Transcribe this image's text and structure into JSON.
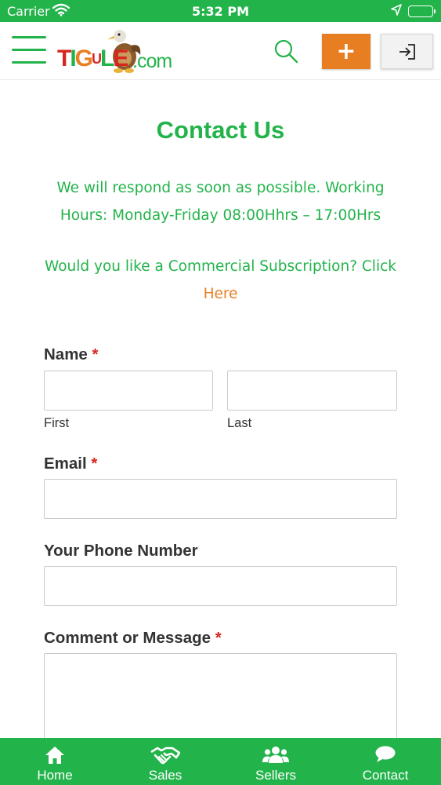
{
  "status_bar": {
    "carrier": "Carrier",
    "time": "5:32 PM"
  },
  "header": {
    "logo": {
      "letters": [
        "T",
        "I",
        "G",
        "U",
        "L",
        "E"
      ],
      "domain": ".com"
    },
    "add_label": "+"
  },
  "page": {
    "title": "Contact Us",
    "intro_line_1": "We will respond as soon as possible. Working",
    "intro_line_2": "Hours: Monday-Friday 08:00Hhrs – 17:00Hrs",
    "subscription_text": "Would you like a Commercial Subscription? Click",
    "subscription_link": "Here"
  },
  "form": {
    "required_marker": "*",
    "name_label": "Name",
    "first_label": "First",
    "last_label": "Last",
    "email_label": "Email",
    "phone_label": "Your Phone Number",
    "message_label": "Comment or Message",
    "first_value": "",
    "last_value": "",
    "email_value": "",
    "phone_value": "",
    "message_value": ""
  },
  "tab_bar": {
    "items": [
      {
        "label": "Home",
        "icon": "home-icon"
      },
      {
        "label": "Sales",
        "icon": "handshake-icon"
      },
      {
        "label": "Sellers",
        "icon": "users-icon"
      },
      {
        "label": "Contact",
        "icon": "chat-bubble-icon"
      }
    ]
  },
  "colors": {
    "brand_green": "#22b34a",
    "accent_orange": "#e87e22",
    "required_red": "#d7261f"
  }
}
